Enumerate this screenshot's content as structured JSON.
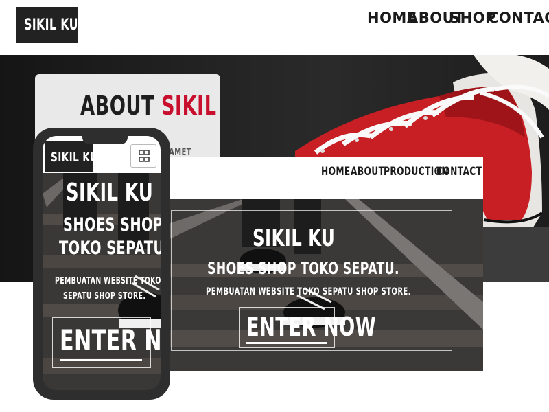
{
  "site": {
    "logo": "SIKIL KU",
    "nav": [
      "HOME",
      "ABOUT",
      "SHOP",
      "CONTACT"
    ]
  },
  "about_card": {
    "title_main": "ABOUT",
    "title_accent": "SIKIL",
    "partial_text": "AMET"
  },
  "desktop": {
    "nav": [
      "HOME",
      "ABOUT",
      "PRODUCTION",
      "CONTACT"
    ],
    "brand": "SIKIL KU",
    "subtitle": "SHOES SHOP TOKO SEPATU.",
    "description": "PEMBUATAN WEBSITE TOKO SEPATU SHOP STORE.",
    "cta": "ENTER NOW"
  },
  "phone": {
    "logo": "SIKIL KU",
    "brand": "SIKIL KU",
    "subtitle_1": "SHOES SHOP",
    "subtitle_2": "TOKO SEPATU.",
    "description_1": "PEMBUATAN WEBSITE TOKO",
    "description_2": "SEPATU SHOP STORE.",
    "cta": "ENTER NOW"
  },
  "colors": {
    "accent": "#c8102e",
    "dark": "#222222",
    "sneaker": "#c81f24"
  },
  "icons": [
    "grid-menu-icon",
    "red-sneaker-image",
    "railway-shoes-image"
  ]
}
